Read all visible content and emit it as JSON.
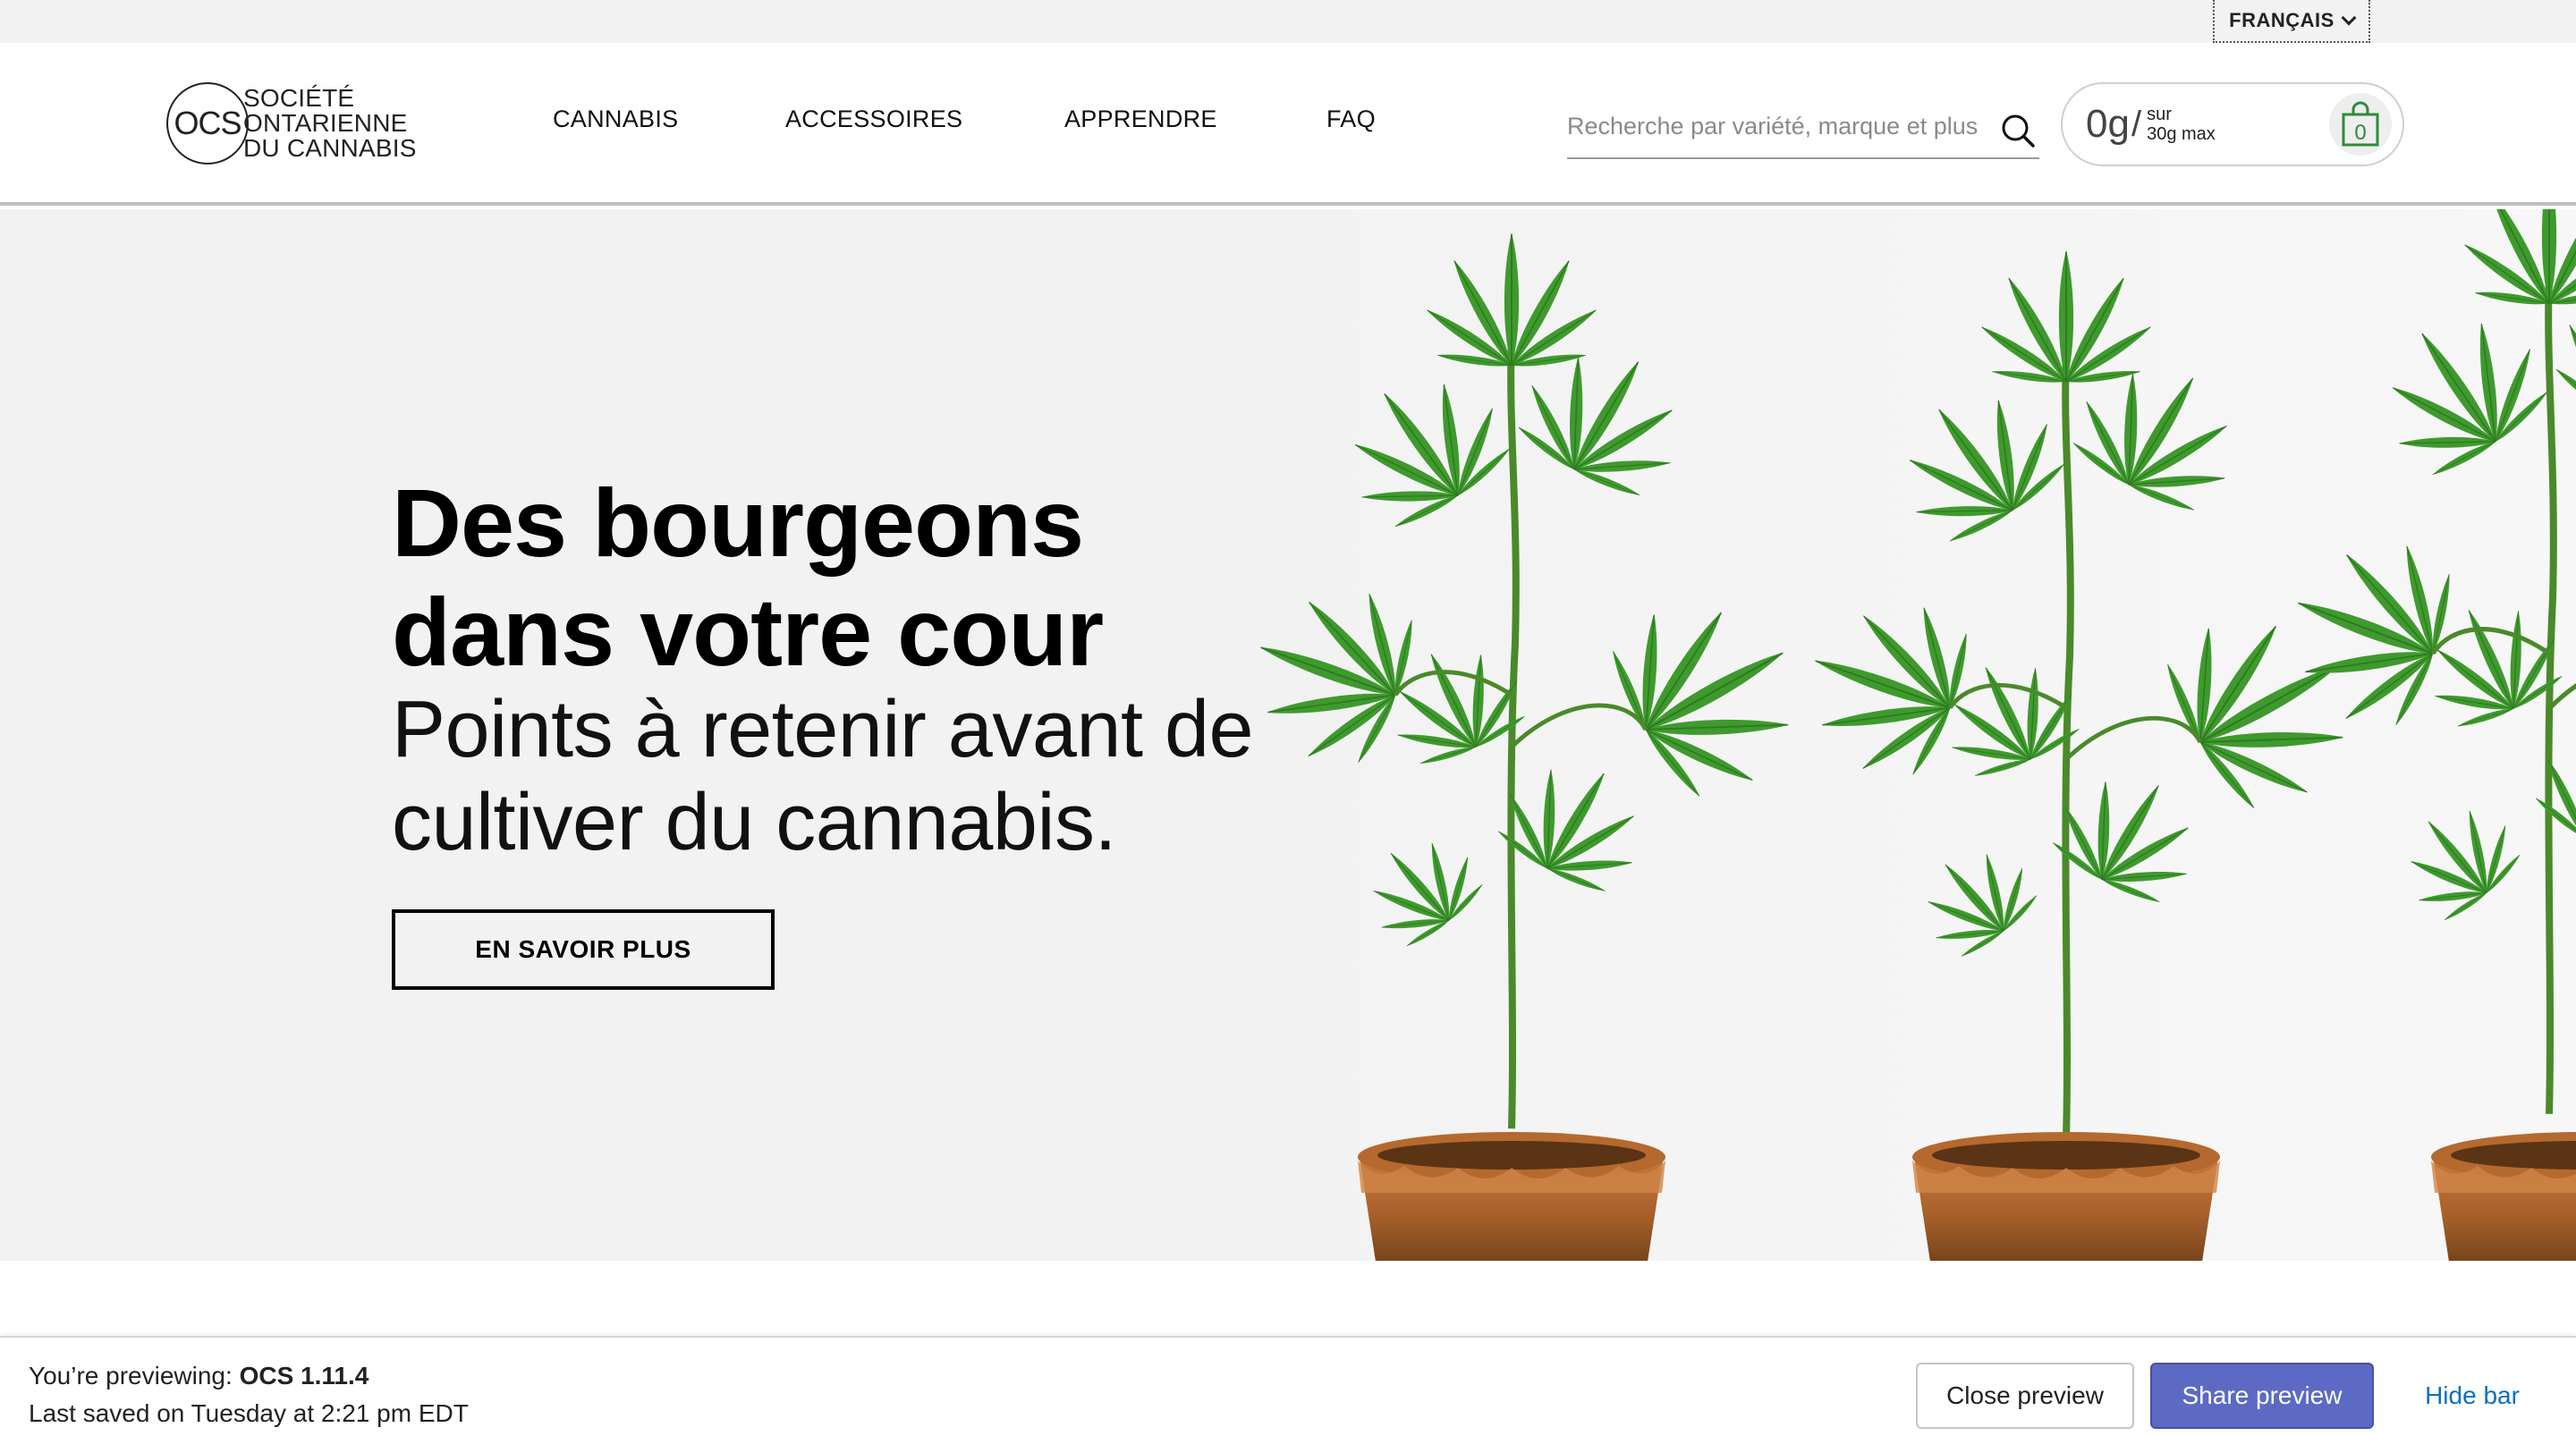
{
  "utility_bar": {
    "language_label": "FRANÇAIS"
  },
  "header": {
    "logo": {
      "mark": "OCS",
      "line1": "SOCIÉTÉ",
      "line2": "ONTARIENNE",
      "line3": "DU CANNABIS"
    },
    "nav": [
      {
        "label": "CANNABIS"
      },
      {
        "label": "ACCESSOIRES"
      },
      {
        "label": "APPRENDRE"
      },
      {
        "label": "FAQ"
      }
    ],
    "search": {
      "placeholder": "Recherche par variété, marque et plus",
      "value": ""
    },
    "cart": {
      "amount": "0g",
      "slash": "/",
      "limit_line1": "sur",
      "limit_line2": "30g max",
      "count": "0",
      "accent_color": "#2e8b3a"
    }
  },
  "hero": {
    "title_line1": "Des bourgeons",
    "title_line2": "dans votre cour",
    "subtitle_line1": "Points à retenir avant de",
    "subtitle_line2": "cultiver du cannabis.",
    "cta_label": "EN SAVOIR PLUS"
  },
  "preview_bar": {
    "previewing_prefix": "You’re previewing: ",
    "theme_name": "OCS 1.11.4",
    "last_saved": "Last saved on Tuesday at 2:21 pm EDT",
    "close_label": "Close preview",
    "share_label": "Share preview",
    "hide_label": "Hide bar",
    "share_color": "#5c6ac4",
    "hide_color": "#0a6fc2"
  }
}
